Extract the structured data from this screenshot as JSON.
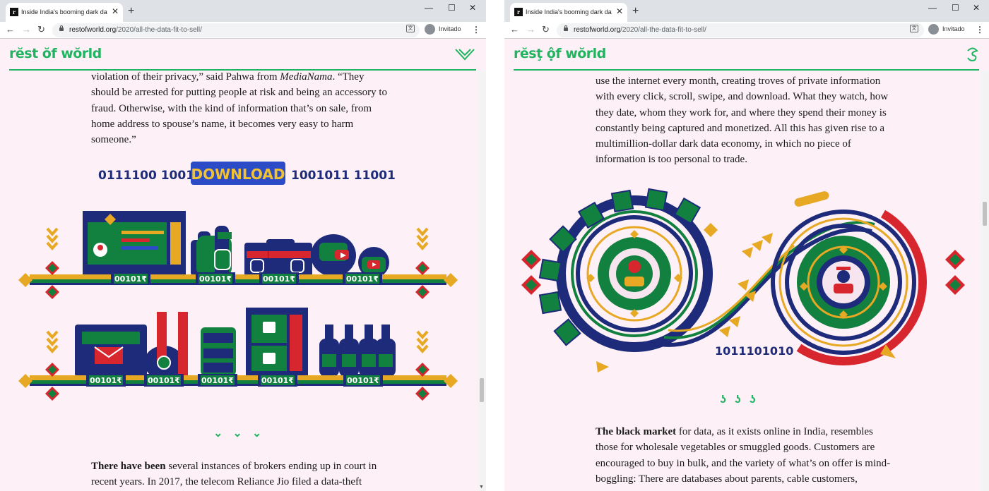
{
  "left": {
    "tab_title": "Inside India's booming dark data",
    "url_host": "restofworld.org",
    "url_path": "/2020/all-the-data-fit-to-sell/",
    "profile_label": "Invitado",
    "logo_text": "rĕst ŏf wŏrld",
    "para1_a": "violation of their privacy,” said Pahwa from ",
    "para1_em": "MediaNama",
    "para1_b": ". “They should be arrested for putting people at risk and being an accessory to fraud. Otherwise, with the kind of information that’s on sale, from home address to spouse’s name, it becomes very easy to harm someone.”",
    "banner_left": "0111100  1001",
    "banner_button": "DOWNLOAD",
    "banner_right": "1001011  11001",
    "price_tag": "00101₹",
    "divider": "⌄⌄⌄",
    "para2_bold": "There have been",
    "para2_text": " several instances of brokers ending up in court in recent years. In 2017, the telecom Reliance Jio filed a data-theft"
  },
  "right": {
    "tab_title": "Inside India's booming dark data",
    "url_host": "restofworld.org",
    "url_path": "/2020/all-the-data-fit-to-sell/",
    "profile_label": "Invitado",
    "logo_text": "rĕsţ ộf wŏrld",
    "para1": "use the internet every month, creating troves of private information with every click, scroll, swipe, and download. What they watch, how they date, whom they work for, and where they spend their money is constantly being captured and monetized. All this has given rise to a multimillion-dollar dark data economy, in which no piece of information is too personal to trade.",
    "binary_label": "1011101010",
    "divider": "ʖʖʖ",
    "para2_bold": "The black market",
    "para2_text": " for data, as it exists online in India, resembles those for wholesale vegetables or smuggled goods. Customers are encouraged to buy in bulk, and the variety of what’s on offer is mind-boggling: There are databases about parents, cable customers,"
  },
  "colors": {
    "brand_green": "#1fb460",
    "page_bg": "#fdf0f6",
    "navy": "#1d2b7a",
    "gold": "#e7a824",
    "red": "#d8262f",
    "teal": "#12813f"
  }
}
